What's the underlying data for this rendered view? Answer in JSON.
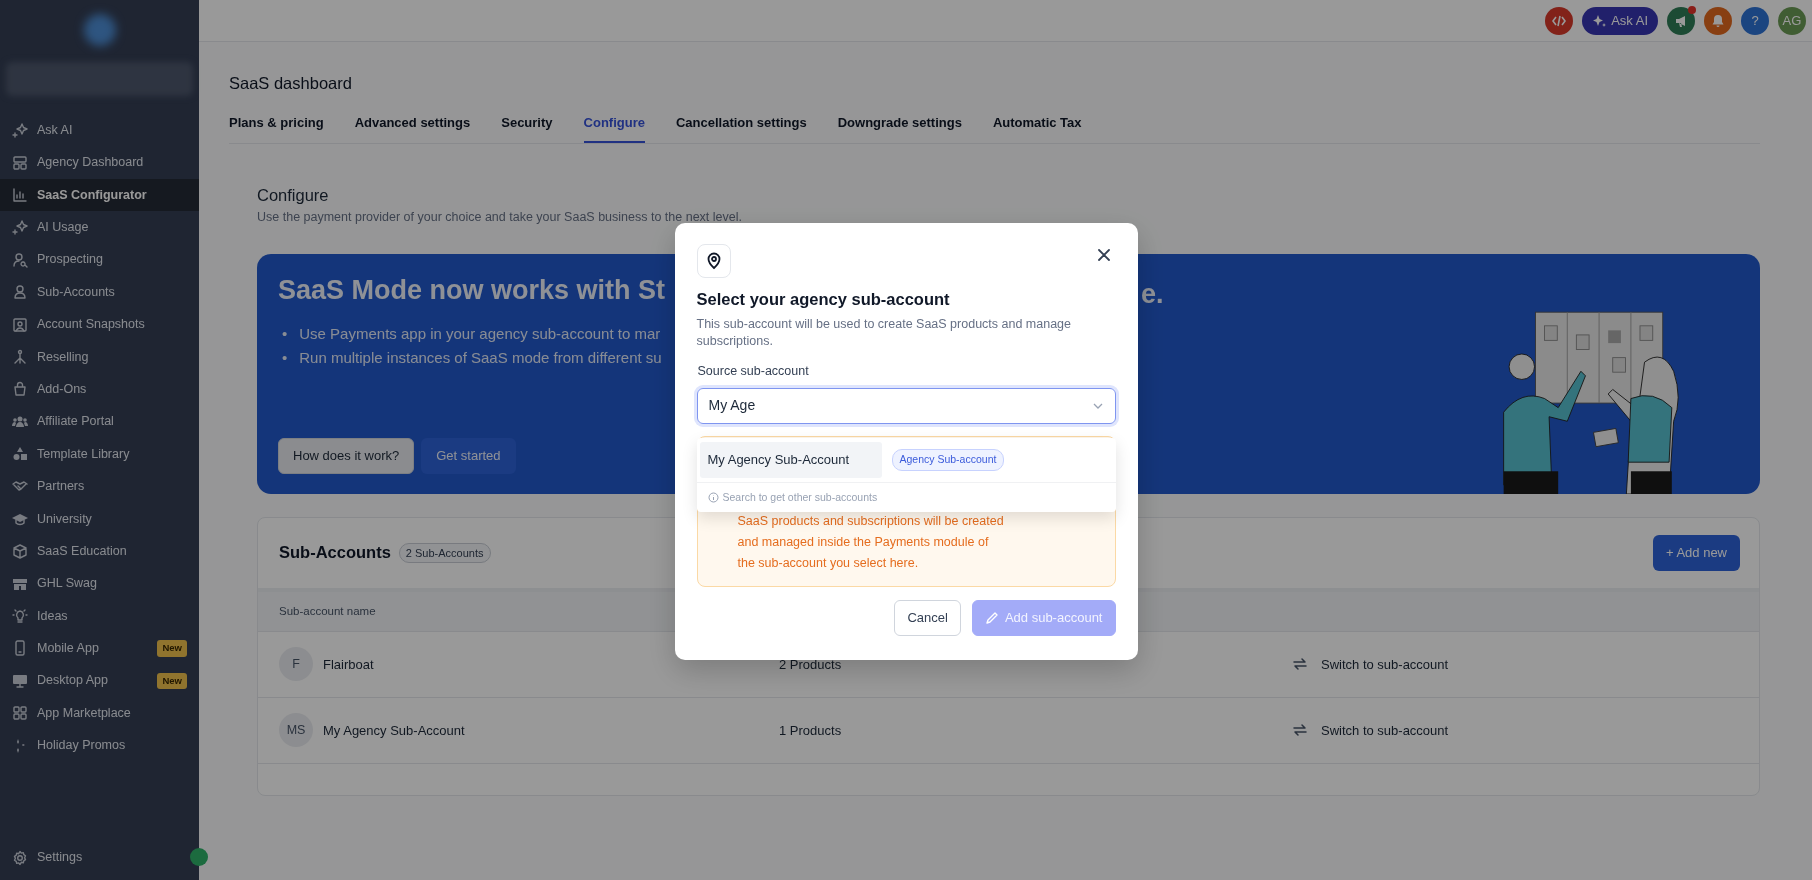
{
  "sidebar": {
    "items": [
      {
        "label": "Ask AI",
        "selected": false
      },
      {
        "label": "Agency Dashboard",
        "selected": false
      },
      {
        "label": "SaaS Configurator",
        "selected": true
      },
      {
        "label": "AI Usage",
        "selected": false
      },
      {
        "label": "Prospecting",
        "selected": false
      },
      {
        "label": "Sub-Accounts",
        "selected": false
      },
      {
        "label": "Account Snapshots",
        "selected": false
      },
      {
        "label": "Reselling",
        "selected": false
      },
      {
        "label": "Add-Ons",
        "selected": false
      },
      {
        "label": "Affiliate Portal",
        "selected": false
      },
      {
        "label": "Template Library",
        "selected": false
      },
      {
        "label": "Partners",
        "selected": false
      },
      {
        "label": "University",
        "selected": false
      },
      {
        "label": "SaaS Education",
        "selected": false
      },
      {
        "label": "GHL Swag",
        "selected": false
      },
      {
        "label": "Ideas",
        "selected": false
      },
      {
        "label": "Mobile App",
        "selected": false,
        "badge": "New"
      },
      {
        "label": "Desktop App",
        "selected": false,
        "badge": "New"
      },
      {
        "label": "App Marketplace",
        "selected": false
      },
      {
        "label": "Holiday Promos",
        "selected": false
      }
    ],
    "settings": "Settings"
  },
  "topbar": {
    "ask_ai": "Ask AI",
    "help": "?",
    "avatar": "AG",
    "notification_dot": true
  },
  "page": {
    "title": "SaaS dashboard",
    "tabs": [
      {
        "label": "Plans & pricing",
        "selected": false
      },
      {
        "label": "Advanced settings",
        "selected": false
      },
      {
        "label": "Security",
        "selected": false
      },
      {
        "label": "Configure",
        "selected": true
      },
      {
        "label": "Cancellation settings",
        "selected": false
      },
      {
        "label": "Downgrade settings",
        "selected": false
      },
      {
        "label": "Automatic Tax",
        "selected": false
      }
    ]
  },
  "configure": {
    "title": "Configure",
    "subtitle": "Use the payment provider of your choice and take your SaaS business to the next level."
  },
  "banner": {
    "title": "SaaS Mode now works with St",
    "title_tail": "e.",
    "bullets": [
      {
        "marker": "•",
        "text": "Use Payments app in your agency sub-account to mar"
      },
      {
        "marker": "•",
        "text": "Run multiple instances of SaaS mode from different su"
      }
    ],
    "buttons": [
      {
        "label": "How does it work?",
        "kind": "secondary"
      },
      {
        "label": "Get started",
        "kind": "primary"
      }
    ]
  },
  "sub_accounts": {
    "title": "Sub-Accounts",
    "count": "2 Sub-Accounts",
    "add_button": "+ Add new",
    "columns": [
      "Sub-account name"
    ],
    "rows": [
      {
        "initials": "F",
        "name": "Flairboat",
        "products": "2 Products",
        "action": "Switch to sub-account"
      },
      {
        "initials": "MS",
        "name": "My Agency Sub-Account",
        "products": "1 Products",
        "action": "Switch to sub-account"
      }
    ]
  },
  "modal": {
    "title": "Select your agency sub-account",
    "description": "This sub-account will be used to create SaaS products and manage subscriptions.",
    "field_label": "Source sub-account",
    "field_value": "My Age",
    "options": [
      {
        "label": "My Agency Sub-Account",
        "tag": "Agency Sub-account",
        "selected": true
      }
    ],
    "hint": "Search to get other sub-accounts",
    "warning": "SaaS products and subscriptions will be created and managed inside the Payments module of the sub-account you select here.",
    "buttons": [
      {
        "label": "Cancel",
        "kind": "secondary",
        "disabled": false
      },
      {
        "label": "Add sub-account",
        "kind": "primary",
        "disabled": true
      }
    ]
  }
}
